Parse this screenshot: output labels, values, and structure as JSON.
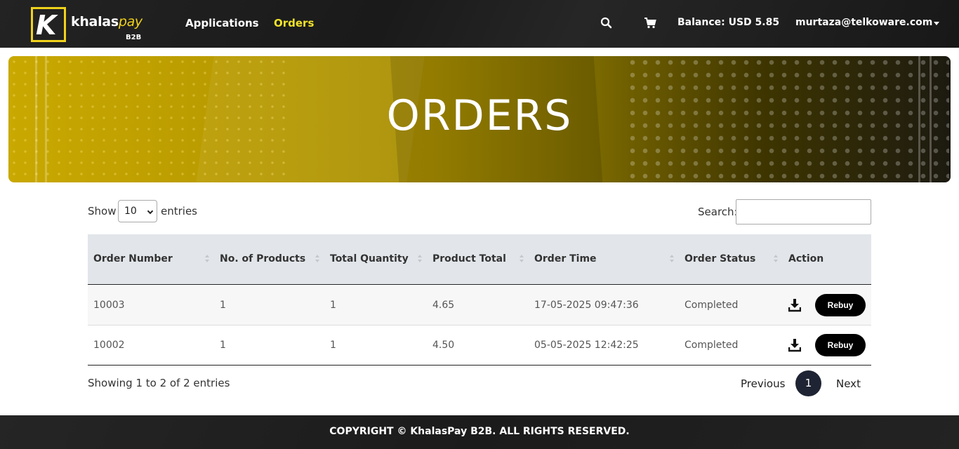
{
  "brand": {
    "name_main": "khalas",
    "name_accent": "pay",
    "sub": "B2B",
    "mark": "K"
  },
  "nav": {
    "applications": "Applications",
    "orders": "Orders",
    "balance": "Balance: USD 5.85",
    "user": "murtaza@telkoware.com",
    "accent_color": "#f0e22a"
  },
  "banner": {
    "title": "ORDERS"
  },
  "controls": {
    "show_label": "Show",
    "entries_value": "10",
    "entries_label": "entries",
    "search_label": "Search:",
    "search_value": ""
  },
  "table": {
    "headers": [
      "Order Number",
      "No. of Products",
      "Total Quantity",
      "Product Total",
      "Order Time",
      "Order Status",
      "Action"
    ],
    "rows": [
      {
        "order_number": "10003",
        "products": "1",
        "quantity": "1",
        "total": "4.65",
        "time": "17-05-2025 09:47:36",
        "status": "Completed",
        "action": "Rebuy"
      },
      {
        "order_number": "10002",
        "products": "1",
        "quantity": "1",
        "total": "4.50",
        "time": "05-05-2025 12:42:25",
        "status": "Completed",
        "action": "Rebuy"
      }
    ]
  },
  "pagination": {
    "info": "Showing 1 to 2 of 2 entries",
    "previous": "Previous",
    "current": "1",
    "next": "Next"
  },
  "footer": {
    "copyright": "COPYRIGHT © KhalasPay B2B. ALL RIGHTS RESERVED."
  }
}
